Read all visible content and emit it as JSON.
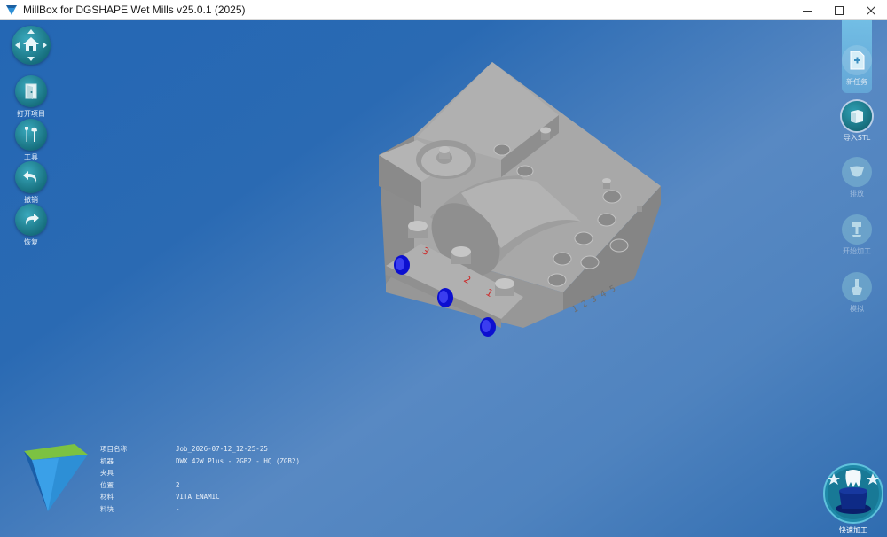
{
  "window": {
    "title": "MillBox for DGSHAPE Wet Mills v25.0.1 (2025)",
    "icon": "millbox-logo-icon"
  },
  "left_toolbar": {
    "items": [
      {
        "name": "home",
        "label": "",
        "icon": "home-nav-icon"
      },
      {
        "name": "open-project",
        "label": "打开项目",
        "icon": "open-door-icon"
      },
      {
        "name": "tools",
        "label": "工具",
        "icon": "tools-icon"
      },
      {
        "name": "undo",
        "label": "撤销",
        "icon": "undo-icon"
      },
      {
        "name": "redo",
        "label": "恢复",
        "icon": "redo-icon"
      }
    ]
  },
  "right_toolbar": {
    "items": [
      {
        "name": "new-task",
        "label": "新任务",
        "icon": "new-document-icon",
        "state": "highlighted"
      },
      {
        "name": "import-stl",
        "label": "导入STL",
        "icon": "import-stl-icon",
        "state": "active"
      },
      {
        "name": "nesting",
        "label": "排放",
        "icon": "nesting-icon",
        "state": "disabled"
      },
      {
        "name": "start-machining",
        "label": "开始加工",
        "icon": "machining-icon",
        "state": "disabled"
      },
      {
        "name": "simulate",
        "label": "模拟",
        "icon": "simulate-icon",
        "state": "disabled"
      }
    ]
  },
  "info": {
    "project_name_label": "项目名称",
    "project_name": "Job_2026-07-12_12-25-25",
    "machine_label": "机器",
    "machine": "DWX 42W Plus - ZGB2 - HQ (ZGB2)",
    "fixture_label": "夹具",
    "fixture": "",
    "position_label": "位置",
    "position": "2",
    "material_label": "材料",
    "material": "VITA ENAMIC",
    "block_label": "料块",
    "block": "-"
  },
  "fixture_model": {
    "slot_numbers": [
      "3",
      "2",
      "1"
    ],
    "engraved_numbers": "1 2 3 4 5"
  },
  "quick_mill": {
    "label": "快速加工",
    "icon": "magic-hat-tooth-icon"
  },
  "colors": {
    "background_top": "#2467b4",
    "background_mid": "#5889c3",
    "button_teal": "#17707f",
    "model_gray": "#a3a3a3",
    "pin_blue": "#0c0fd0",
    "slot_number_red": "#cc2b2b",
    "logo_green": "#7cc242",
    "logo_blue": "#2d8fd6"
  }
}
